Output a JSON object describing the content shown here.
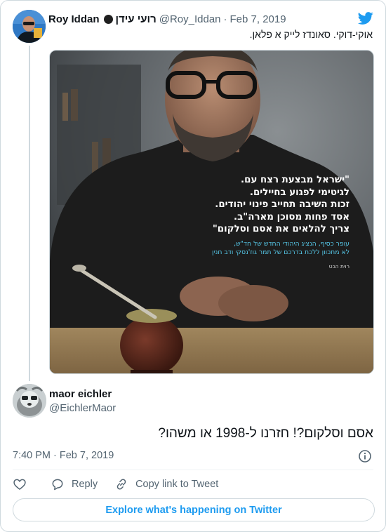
{
  "parent_tweet": {
    "author_name": "Roy Iddan",
    "author_hebrew_name": "רועי עידן",
    "handle": "@Roy_Iddan",
    "date": "Feb 7, 2019",
    "text": "אוקי-דוקי. סאונדז לייק א פלאן."
  },
  "photo_overlay": {
    "quote_lines": [
      "\"ישראל מבצעת רצח עם.",
      "לגיטימי לפגוע בחיילים.",
      "זכות השיבה תחייב פינוי יהודים.",
      "אסד פחות מסוכן מארה\"ב.",
      "צריך להלאים את אסם וסלקום\""
    ],
    "sub_lines": [
      "עופר כסיף, הנציג היהודי החדש של חד\"ש,",
      "לא מתכוון ללכת בדרכם של תמר גוז'נסקי ודב חנין"
    ],
    "credit": "רוית הכט"
  },
  "main_tweet": {
    "author_name": "maor eichler",
    "handle": "@EichlerMaor",
    "text": "אסם וסלקום?! חזרנו ל-1998 או משהו?",
    "timestamp": "7:40 PM · Feb 7, 2019"
  },
  "actions": {
    "reply_label": "Reply",
    "copy_link_label": "Copy link to Tweet"
  },
  "explore_label": "Explore what's happening on Twitter",
  "icons": {
    "brand": "twitter-bird-icon",
    "like": "heart-icon",
    "reply": "speech-bubble-icon",
    "copy": "link-icon",
    "info": "info-icon"
  },
  "colors": {
    "accent": "#1d9bf0",
    "muted_text": "#536471",
    "border": "#cfd9de",
    "overlay_sub": "#55c6e6"
  }
}
